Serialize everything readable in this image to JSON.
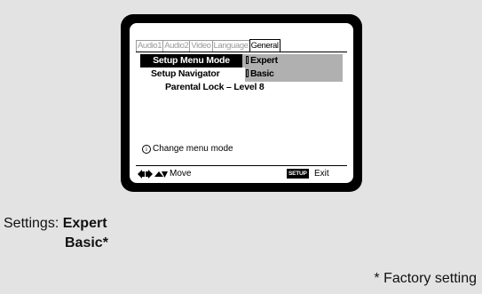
{
  "tabs": [
    "Audio1",
    "Audio2",
    "Video",
    "Language",
    "General"
  ],
  "active_tab": "General",
  "menu": {
    "setup_menu_mode_label": "Setup Menu Mode",
    "setup_menu_mode_value": "Expert",
    "setup_navigator_label": "Setup Navigator",
    "setup_navigator_value": "Basic",
    "parental_lock_label": "Parental Lock – Level 8"
  },
  "help": {
    "icon_glyph": "i",
    "text": "Change menu mode"
  },
  "footer": {
    "move_label": "Move",
    "setup_key": "SETUP",
    "exit_label": "Exit",
    "arrow_icons": [
      "left-arrow-icon",
      "right-arrow-icon",
      "up-arrow-icon",
      "down-arrow-icon"
    ]
  },
  "settings": {
    "label": "Settings:",
    "option1": "Expert",
    "option2": "Basic*"
  },
  "footnote": "* Factory setting",
  "colors": {
    "page_background": "#e3e3e3",
    "bezel": "#000000",
    "screen": "#ffffff",
    "highlight_bar": "#b0b0b0"
  }
}
